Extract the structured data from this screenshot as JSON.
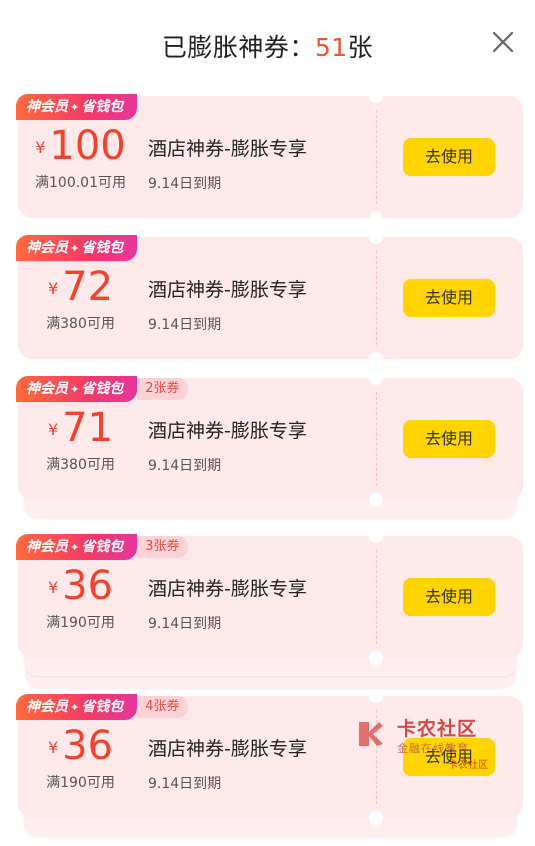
{
  "header": {
    "title_prefix": "已膨胀神券：",
    "count": "51",
    "title_suffix": "张"
  },
  "colors": {
    "accent": "#f0432f",
    "button": "#ffd400",
    "card_bg": "#fde9ea"
  },
  "coupons": [
    {
      "tag": "神会员",
      "tag2": "省钱包",
      "multi": "",
      "currency": "¥",
      "amount": "100",
      "condition": "满100.01可用",
      "name": "酒店神券-膨胀专享",
      "expire": "9.14日到期",
      "button": "去使用"
    },
    {
      "tag": "神会员",
      "tag2": "省钱包",
      "multi": "",
      "currency": "¥",
      "amount": "72",
      "condition": "满380可用",
      "name": "酒店神券-膨胀专享",
      "expire": "9.14日到期",
      "button": "去使用"
    },
    {
      "tag": "神会员",
      "tag2": "省钱包",
      "multi": "2张券",
      "currency": "¥",
      "amount": "71",
      "condition": "满380可用",
      "name": "酒店神券-膨胀专享",
      "expire": "9.14日到期",
      "button": "去使用"
    },
    {
      "tag": "神会员",
      "tag2": "省钱包",
      "multi": "3张券",
      "currency": "¥",
      "amount": "36",
      "condition": "满190可用",
      "name": "酒店神券-膨胀专享",
      "expire": "9.14日到期",
      "button": "去使用"
    },
    {
      "tag": "神会员",
      "tag2": "省钱包",
      "multi": "4张券",
      "currency": "¥",
      "amount": "36",
      "condition": "满190可用",
      "name": "酒店神券-膨胀专享",
      "expire": "9.14日到期",
      "button": "去使用"
    }
  ],
  "watermark": {
    "title": "卡农社区",
    "subtitle": "金融在线教育",
    "small": "卡农社区"
  },
  "icons": {
    "close": "close-icon",
    "star": "diamond-star-icon",
    "watermark_logo": "kanong-logo-icon"
  }
}
